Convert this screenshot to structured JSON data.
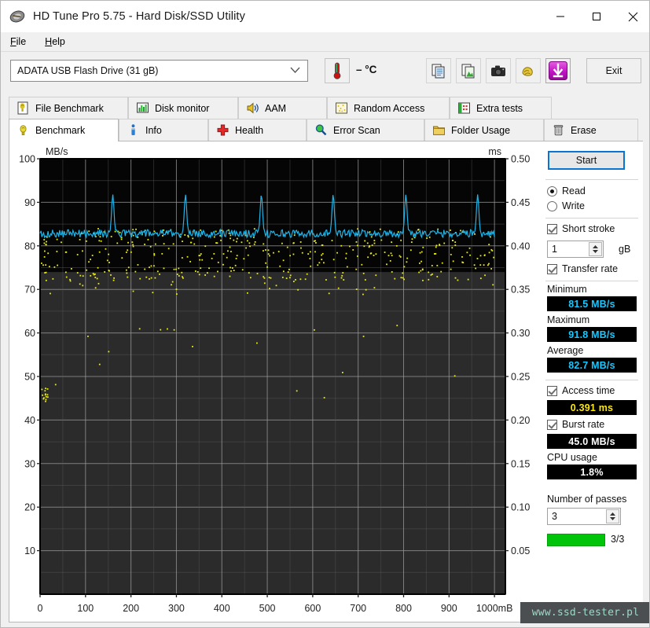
{
  "window": {
    "title": "HD Tune Pro 5.75 - Hard Disk/SSD Utility",
    "icon": "hdd-icon",
    "minimize": "minimize-icon",
    "maximize": "maximize-icon",
    "close": "close-icon"
  },
  "menu": {
    "items": [
      {
        "label": "File",
        "accel": "F"
      },
      {
        "label": "Help",
        "accel": "H"
      }
    ]
  },
  "toolbar": {
    "drive": "ADATA  USB Flash Drive (31 gB)",
    "temperature": "– °C",
    "temp_icon": "thermometer-icon",
    "buttons": [
      {
        "name": "copy-icon",
        "title": "copy"
      },
      {
        "name": "copy-image-icon",
        "title": "copy image"
      },
      {
        "name": "camera-icon",
        "title": "screenshot"
      },
      {
        "name": "folder-bundle-icon",
        "title": "options"
      },
      {
        "name": "download-arrow-icon",
        "title": "save"
      }
    ],
    "exit": "Exit"
  },
  "tabs": {
    "top_row": [
      {
        "label": "File Benchmark",
        "icon": "file-benchmark-icon",
        "active": false,
        "width": 152
      },
      {
        "label": "Disk monitor",
        "icon": "disk-monitor-icon",
        "active": false,
        "width": 140
      },
      {
        "label": "AAM",
        "icon": "speaker-icon",
        "active": false,
        "width": 113
      },
      {
        "label": "Random Access",
        "icon": "random-access-icon",
        "active": false,
        "width": 156
      },
      {
        "label": "Extra tests",
        "icon": "extra-tests-icon",
        "active": false,
        "width": 130
      }
    ],
    "bottom_row": [
      {
        "label": "Benchmark",
        "icon": "lightbulb-icon",
        "active": true,
        "width": 140
      },
      {
        "label": "Info",
        "icon": "info-icon",
        "active": false,
        "width": 114
      },
      {
        "label": "Health",
        "icon": "health-cross-icon",
        "active": false,
        "width": 125
      },
      {
        "label": "Error Scan",
        "icon": "magnifier-icon",
        "active": false,
        "width": 150
      },
      {
        "label": "Folder Usage",
        "icon": "folder-icon",
        "active": false,
        "width": 152
      },
      {
        "label": "Erase",
        "icon": "trash-icon",
        "active": false,
        "width": 120
      }
    ]
  },
  "panel": {
    "start_label": "Start",
    "mode": {
      "read_label": "Read",
      "write_label": "Write",
      "selected": "Read"
    },
    "short_stroke": {
      "label": "Short stroke",
      "checked": true,
      "value": "1",
      "unit": "gB"
    },
    "transfer_rate": {
      "label": "Transfer rate",
      "checked": true
    },
    "minimum": {
      "label": "Minimum",
      "value": "81.5 MB/s"
    },
    "maximum": {
      "label": "Maximum",
      "value": "91.8 MB/s"
    },
    "average": {
      "label": "Average",
      "value": "82.7 MB/s"
    },
    "access_time": {
      "label": "Access time",
      "checked": true,
      "value": "0.391 ms"
    },
    "burst_rate": {
      "label": "Burst rate",
      "checked": true,
      "value": "45.0 MB/s"
    },
    "cpu_usage": {
      "label": "CPU usage",
      "value": "1.8%"
    },
    "passes": {
      "label": "Number of passes",
      "value": "3",
      "progress_text": "3/3",
      "progress_pct": 100
    }
  },
  "watermark": {
    "text": "www.ssd-tester.pl"
  },
  "chart_data": {
    "type": "line",
    "title": "",
    "ylabel": "MB/s",
    "y2label": "ms",
    "xlabel": "mB",
    "ylim": [
      0,
      100
    ],
    "y2lim": [
      0,
      0.55
    ],
    "xlim": [
      0,
      1024
    ],
    "grid": true,
    "y_ticks": [
      10,
      20,
      30,
      40,
      50,
      60,
      70,
      80,
      90,
      100
    ],
    "y2_ticks": [
      0.05,
      0.1,
      0.15,
      0.2,
      0.25,
      0.3,
      0.35,
      0.4,
      0.45,
      0.5
    ],
    "x_ticks": [
      0,
      100,
      200,
      300,
      400,
      500,
      600,
      700,
      800,
      900,
      1000
    ],
    "x_tick_labels": [
      "0",
      "100",
      "200",
      "300",
      "400",
      "500",
      "600",
      "700",
      "800",
      "900",
      "1000mB"
    ],
    "plot_bg": "#0a0a0a",
    "grid_color": "#9a9a9a",
    "series": [
      {
        "name": "Transfer rate",
        "color": "#1fb4e8",
        "type": "line",
        "unit": "MB/s",
        "axis": "left",
        "baseline": 82.7,
        "min": 81.5,
        "max": 91.8,
        "noise": 0.9,
        "spikes_x": [
          160,
          320,
          487,
          645,
          805,
          963
        ],
        "spike_peak": 91.8,
        "points": 512
      },
      {
        "name": "Access time",
        "color": "#eaea16",
        "type": "scatter",
        "unit": "ms",
        "axis": "right",
        "cluster_center": 0.391,
        "cluster_spread": 0.03,
        "outlier_low_ms": 0.22,
        "points": 420
      }
    ]
  }
}
